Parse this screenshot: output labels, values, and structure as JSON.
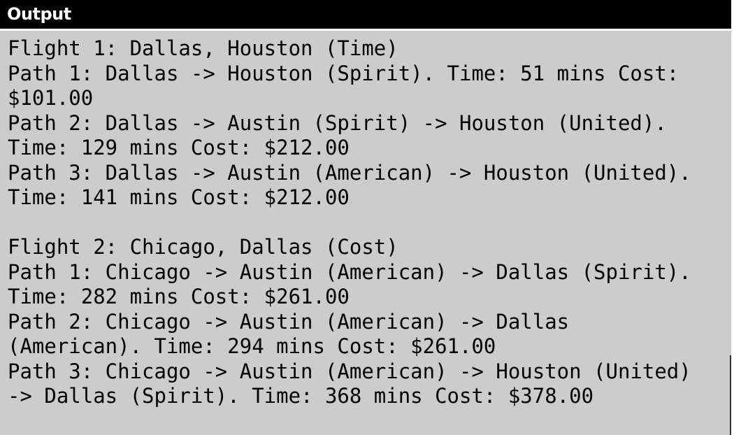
{
  "header": {
    "title": "Output"
  },
  "output": {
    "lines": [
      "Flight 1: Dallas, Houston (Time)",
      "Path 1: Dallas -> Houston (Spirit). Time: 51 mins Cost:",
      "$101.00",
      "Path 2: Dallas -> Austin (Spirit) -> Houston (United).",
      "Time: 129 mins Cost: $212.00",
      "Path 3: Dallas -> Austin (American) -> Houston (United).",
      "Time: 141 mins Cost: $212.00",
      "",
      "Flight 2: Chicago, Dallas (Cost)",
      "Path 1: Chicago -> Austin (American) -> Dallas (Spirit).",
      "Time: 282 mins Cost: $261.00",
      "Path 2: Chicago -> Austin (American) -> Dallas",
      "(American). Time: 294 mins Cost: $261.00",
      "Path 3: Chicago -> Austin (American) -> Houston (United)",
      "-> Dallas (Spirit). Time: 368 mins Cost: $378.00"
    ]
  },
  "colors": {
    "header_bg": "#000000",
    "header_text": "#ffffff",
    "output_bg": "#cccccc",
    "output_text": "#000000"
  }
}
